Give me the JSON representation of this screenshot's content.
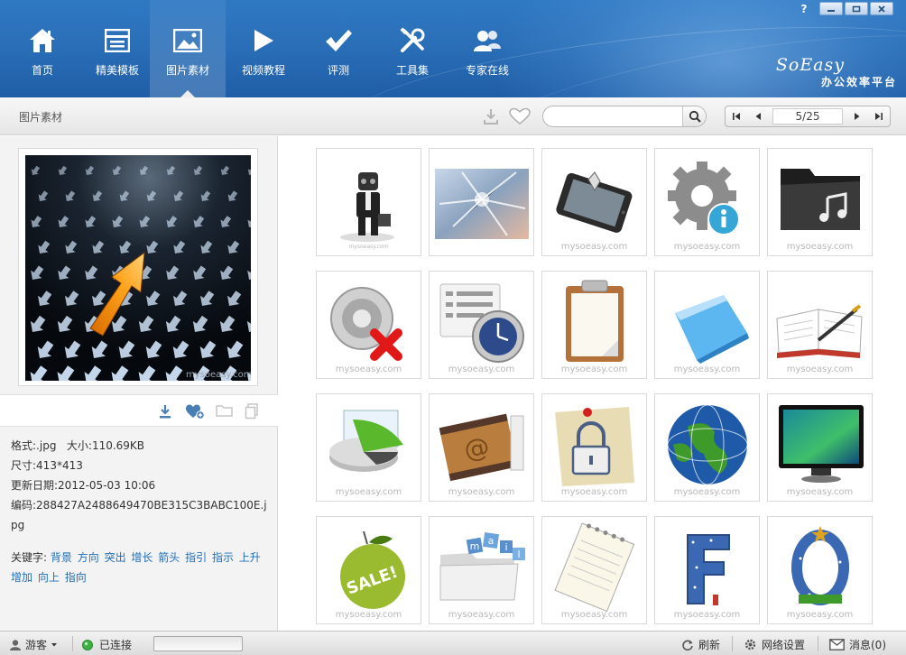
{
  "window": {
    "help_label": "?",
    "brand_logo": "SoEasy",
    "brand_subtitle": "办公效率平台",
    "controls": [
      "minimize",
      "restore",
      "close"
    ]
  },
  "nav": {
    "items": [
      {
        "label": "首页",
        "icon": "home-icon"
      },
      {
        "label": "精美模板",
        "icon": "template-icon"
      },
      {
        "label": "图片素材",
        "icon": "picture-icon",
        "active": true
      },
      {
        "label": "视频教程",
        "icon": "play-icon"
      },
      {
        "label": "评测",
        "icon": "check-icon"
      },
      {
        "label": "工具集",
        "icon": "tools-icon"
      },
      {
        "label": "专家在线",
        "icon": "experts-icon"
      }
    ]
  },
  "toolbar": {
    "title": "图片素材",
    "search": {
      "value": "",
      "placeholder": ""
    },
    "pager": {
      "page": "5/25"
    }
  },
  "preview": {
    "watermark": "mysoeasy.com",
    "format_label": "格式:",
    "format": ".jpg",
    "size_label": "大小:",
    "size": "110.69KB",
    "dimensions_label": "尺寸:",
    "dimensions": "413*413",
    "updated_label": "更新日期:",
    "updated": "2012-05-03 10:06",
    "code_label": "编码:",
    "code": "288427A2488649470BE315C3BABC100E.jpg",
    "keywords_label": "关键字:",
    "keywords": [
      "背景",
      "方向",
      "突出",
      "增长",
      "箭头",
      "指引",
      "指示",
      "上升",
      "增加",
      "向上",
      "指向"
    ]
  },
  "grid": {
    "watermark": "mysoeasy.com",
    "items": [
      {
        "icon": "gasmask-figure-icon"
      },
      {
        "icon": "abstract-burst-icon"
      },
      {
        "icon": "tablet-device-icon"
      },
      {
        "icon": "gear-info-icon"
      },
      {
        "icon": "music-folder-icon"
      },
      {
        "icon": "speaker-mute-icon"
      },
      {
        "icon": "schedule-clock-icon"
      },
      {
        "icon": "clipboard-icon"
      },
      {
        "icon": "blue-folder-icon"
      },
      {
        "icon": "open-book-pen-icon"
      },
      {
        "icon": "pie-chart-disk-icon"
      },
      {
        "icon": "address-book-icon"
      },
      {
        "icon": "lock-note-icon"
      },
      {
        "icon": "globe-icon"
      },
      {
        "icon": "monitor-icon"
      },
      {
        "icon": "sale-apple-icon"
      },
      {
        "icon": "mail-folder-icon"
      },
      {
        "icon": "notepad-icon"
      },
      {
        "icon": "letter-f-icon"
      },
      {
        "icon": "letter-o-icon"
      }
    ]
  },
  "status": {
    "user": "游客",
    "connection": "已连接",
    "refresh": "刷新",
    "network_settings": "网络设置",
    "messages": "消息(0)"
  },
  "colors": {
    "header_blue": "#2a6fb8",
    "link_blue": "#1f6fb8",
    "panel_gray": "#f3f3f3"
  }
}
